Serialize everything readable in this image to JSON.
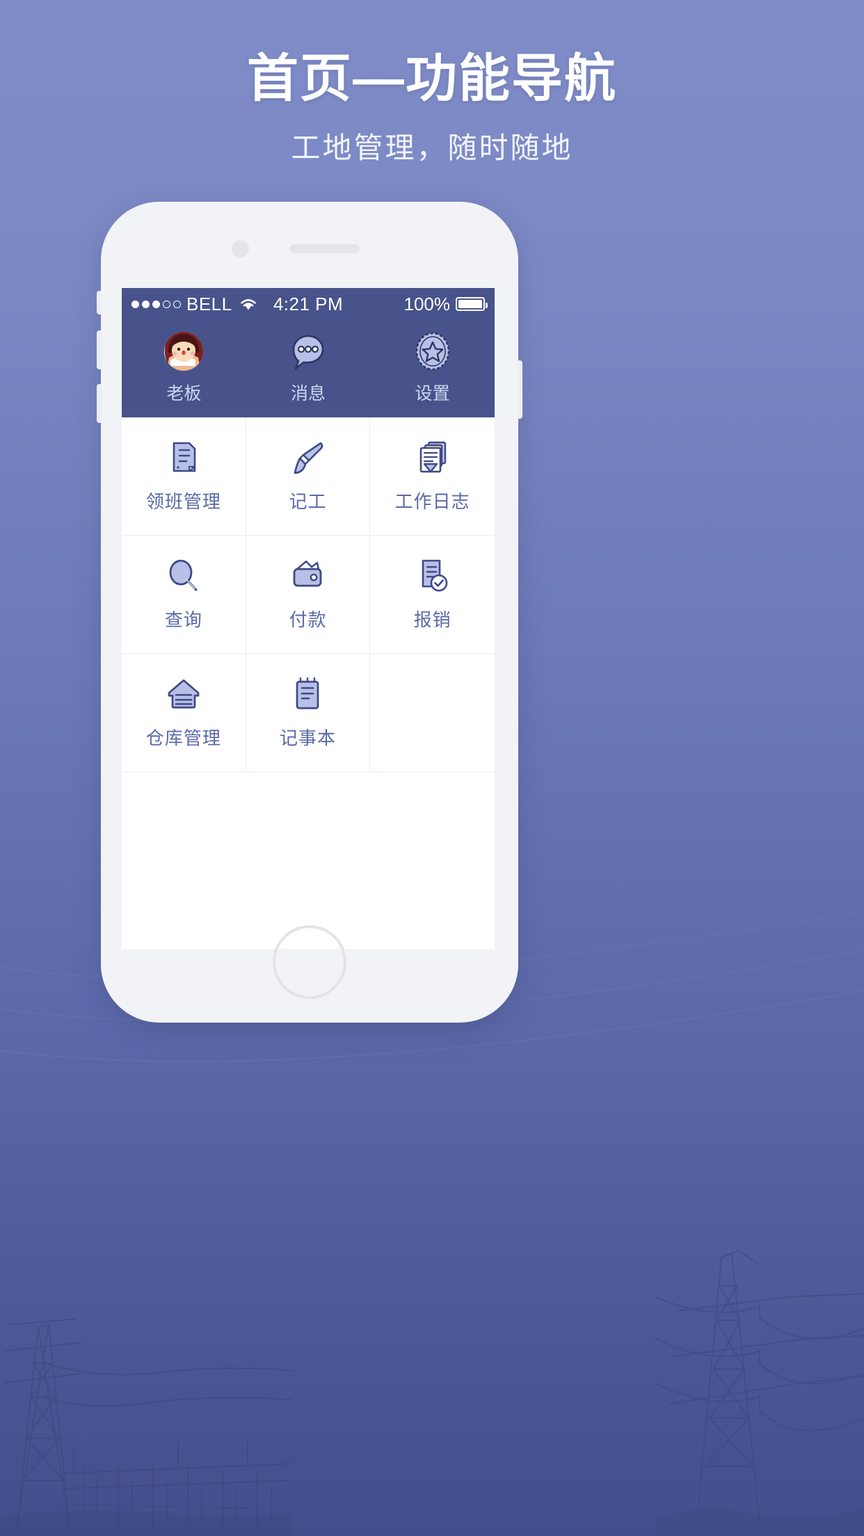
{
  "promo": {
    "title": "首页—功能导航",
    "subtitle": "工地管理，随时随地"
  },
  "colors": {
    "background_top": "#7f8cc7",
    "background_bottom": "#434f8c",
    "statusbar": "#48538c",
    "accent": "#5b6aa8",
    "icon_fill": "#b9c0e8",
    "icon_stroke": "#4d5a96"
  },
  "phone": {
    "status_bar": {
      "signal_dots_filled": 3,
      "signal_dots_total": 5,
      "carrier": "BELL",
      "wifi_icon": "wifi-icon",
      "time": "4:21 PM",
      "battery_percent": "100%",
      "battery_level": 100
    },
    "top_nav": [
      {
        "label": "老板",
        "icon": "avatar-icon"
      },
      {
        "label": "消息",
        "icon": "message-bubble-icon"
      },
      {
        "label": "设置",
        "icon": "star-badge-icon"
      }
    ],
    "grid": [
      {
        "label": "领班管理",
        "icon": "document-icon"
      },
      {
        "label": "记工",
        "icon": "paintbrush-icon"
      },
      {
        "label": "工作日志",
        "icon": "stacked-papers-icon"
      },
      {
        "label": "查询",
        "icon": "magnifier-icon"
      },
      {
        "label": "付款",
        "icon": "wallet-icon"
      },
      {
        "label": "报销",
        "icon": "document-check-icon"
      },
      {
        "label": "仓库管理",
        "icon": "warehouse-icon"
      },
      {
        "label": "记事本",
        "icon": "notepad-icon"
      },
      {
        "label": "",
        "icon": ""
      }
    ]
  }
}
